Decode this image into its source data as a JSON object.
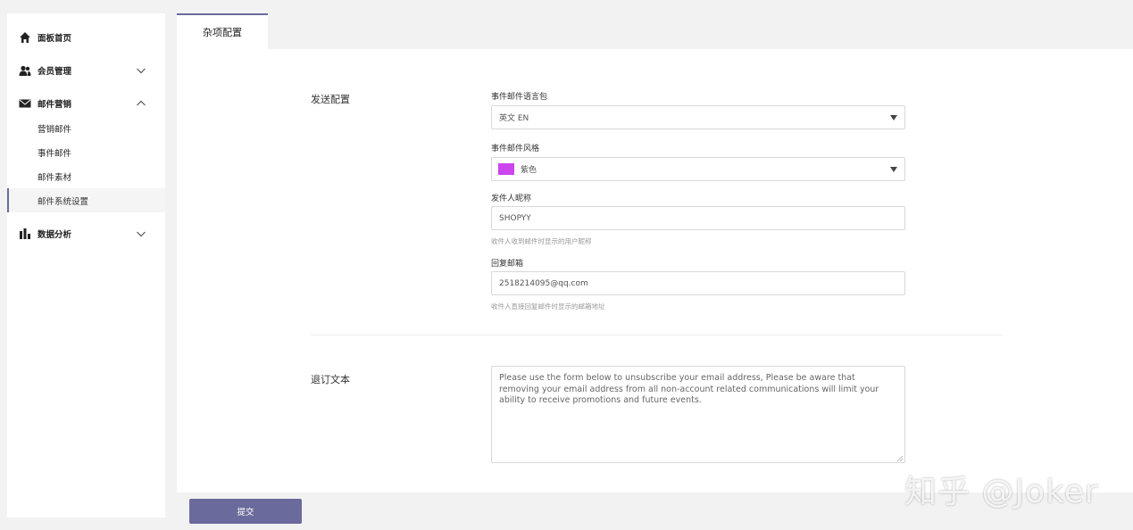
{
  "sidebar": {
    "items": [
      {
        "label": "面板首页",
        "icon": "home-icon"
      },
      {
        "label": "会员管理",
        "icon": "users-icon"
      },
      {
        "label": "邮件营销",
        "icon": "mail-icon"
      },
      {
        "label": "数据分析",
        "icon": "bar-chart-icon"
      }
    ],
    "sub_items": [
      "营销邮件",
      "事件邮件",
      "邮件素材",
      "邮件系统设置"
    ]
  },
  "tabs": {
    "active": "杂项配置"
  },
  "send_config": {
    "title": "发送配置",
    "language_label": "事件邮件语言包",
    "language_value": "英文 EN",
    "style_label": "事件邮件风格",
    "style_value": "紫色",
    "style_color": "#cc44ee",
    "sender_label": "发件人昵称",
    "sender_value": "SHOPYY",
    "sender_help": "收件人收到邮件时显示的用户昵称",
    "reply_label": "回复邮箱",
    "reply_value": "2518214095@qq.com",
    "reply_help": "收件人直接回复邮件时显示的邮箱地址"
  },
  "unsubscribe": {
    "title": "退订文本",
    "text": "Please use the form below to unsubscribe your email address, Please be aware that removing your email address from all non-account related communications will limit your ability to receive promotions and future events."
  },
  "submit_label": "提交",
  "watermark": "知乎 @Joker",
  "colors": {
    "accent": "#6b6a9c"
  }
}
